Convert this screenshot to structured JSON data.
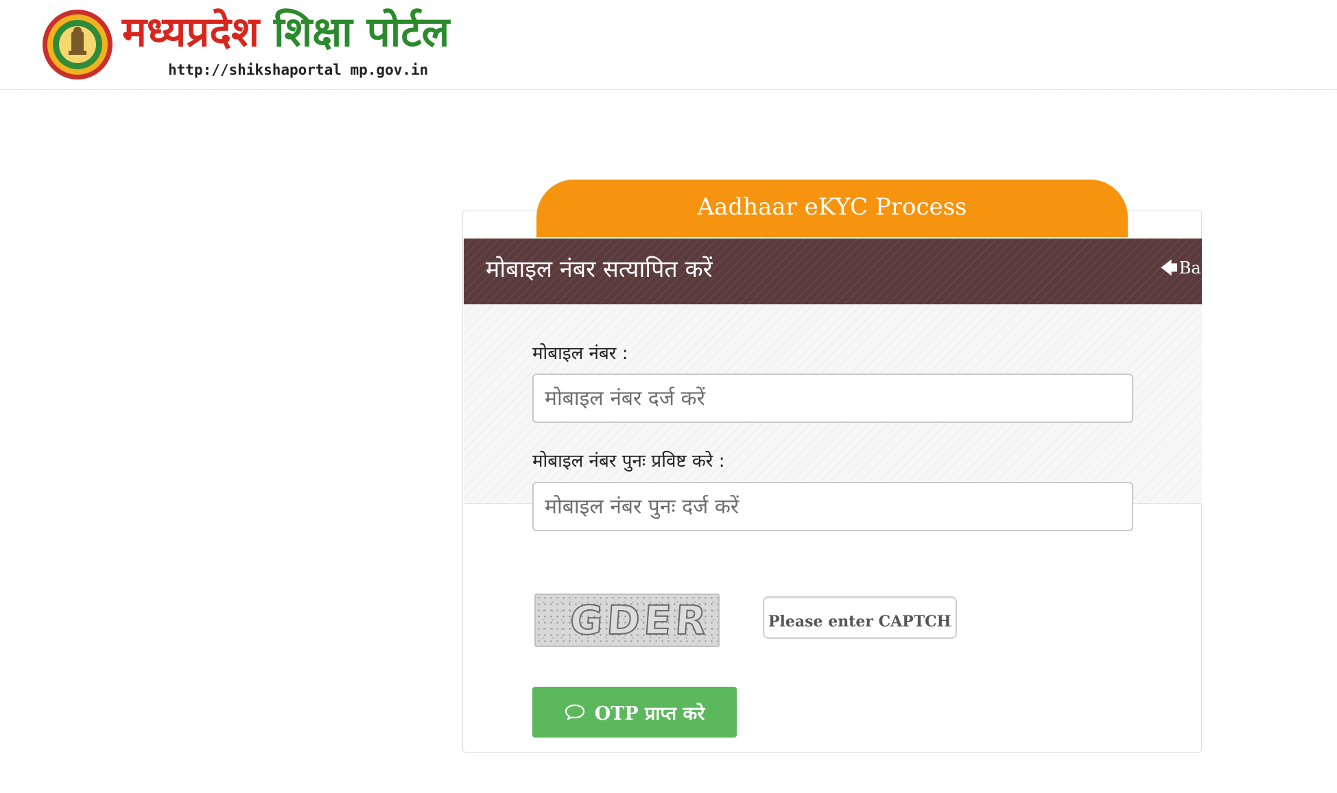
{
  "header": {
    "logo_title_part1": "मध्यप्रदेश",
    "logo_title_part2": "शिक्षा पोर्टल",
    "logo_url": "http://shikshaportal mp.gov.in",
    "logo_icon": "mp-emblem-icon"
  },
  "tab": {
    "title": "Aadhaar eKYC Process",
    "color": "#f7940f"
  },
  "panel": {
    "title": "मोबाइल नंबर सत्यापित करें",
    "back_label": "Bac",
    "back_icon": "arrow-left-icon",
    "header_color": "#5a3a3a"
  },
  "form": {
    "mobile_label": "मोबाइल नंबर :",
    "mobile_placeholder": "मोबाइल नंबर दर्ज करें",
    "mobile_value": "",
    "mobile_confirm_label": "मोबाइल नंबर पुनः प्रविष्ट करे :",
    "mobile_confirm_placeholder": "मोबाइल नंबर पुनः दर्ज करें",
    "mobile_confirm_value": "",
    "captcha_text": "GDER",
    "captcha_placeholder": "Please enter CAPTCHA",
    "captcha_value": ""
  },
  "actions": {
    "otp_label": "OTP प्राप्त करे",
    "otp_icon": "chat-bubble-icon",
    "otp_color": "#5cb85c"
  }
}
